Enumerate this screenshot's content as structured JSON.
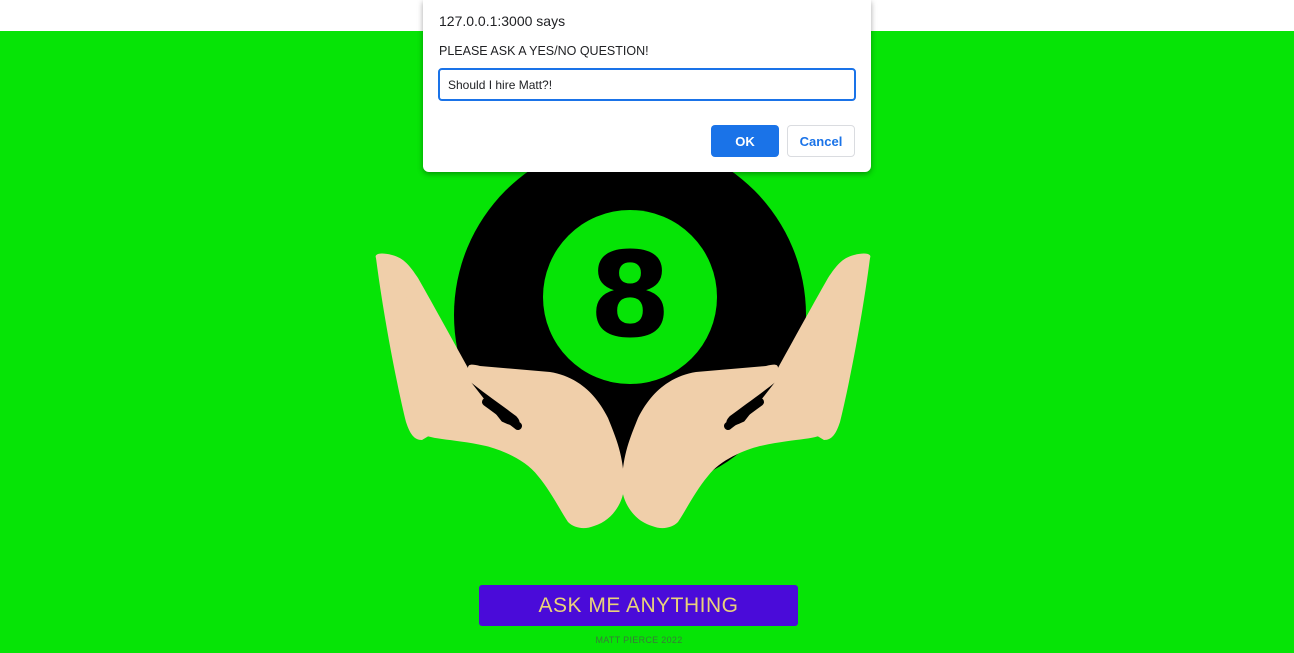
{
  "page": {
    "background_color": "#06e406",
    "ask_button_label": "ASK ME ANYTHING",
    "footer_credit": "MATT PIERCE 2022",
    "illustration": "magic-8-ball-in-hands",
    "ball_number": "8"
  },
  "dialog": {
    "origin": "127.0.0.1:3000 says",
    "message": "PLEASE ASK A YES/NO QUESTION!",
    "input_value": "Should I hire Matt?!",
    "ok_label": "OK",
    "cancel_label": "Cancel"
  },
  "colors": {
    "accent_green": "#06e406",
    "button_purple": "#4a0bd9",
    "button_text_gold": "#e9d27a",
    "dialog_blue": "#1a73e8",
    "skin": "#f0cfaa"
  }
}
